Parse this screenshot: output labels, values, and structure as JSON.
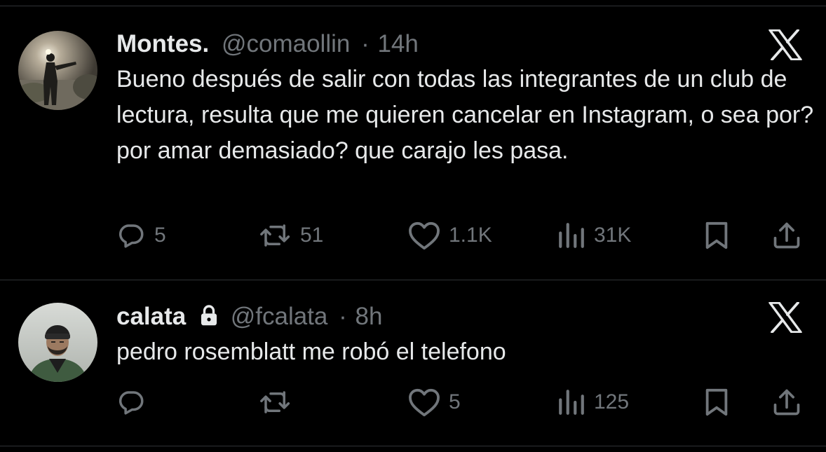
{
  "tweets": [
    {
      "display_name": "Montes.",
      "handle": "@comaollin",
      "separator": "·",
      "time": "14h",
      "text": "Bueno después de salir con todas las integrantes de un club de lectura, resulta que me quieren cancelar en Instagram, o sea por? por amar demasiado? que carajo les pasa.",
      "replies": "5",
      "reposts": "51",
      "likes": "1.1K",
      "views": "31K",
      "protected": false
    },
    {
      "display_name": "calata",
      "handle": "@fcalata",
      "separator": "·",
      "time": "8h",
      "text": "pedro rosemblatt me robó el telefono",
      "replies": "",
      "reposts": "",
      "likes": "5",
      "views": "125",
      "protected": true
    }
  ],
  "icons": {
    "reply": "reply-icon",
    "repost": "repost-icon",
    "like": "heart-icon",
    "views": "views-icon",
    "bookmark": "bookmark-icon",
    "share": "share-icon",
    "brand": "x-logo-icon",
    "protected": "lock-icon"
  },
  "colors": {
    "background": "#000000",
    "primary_text": "#e7e9ea",
    "secondary_text": "#71767b",
    "divider": "#2f3336"
  }
}
